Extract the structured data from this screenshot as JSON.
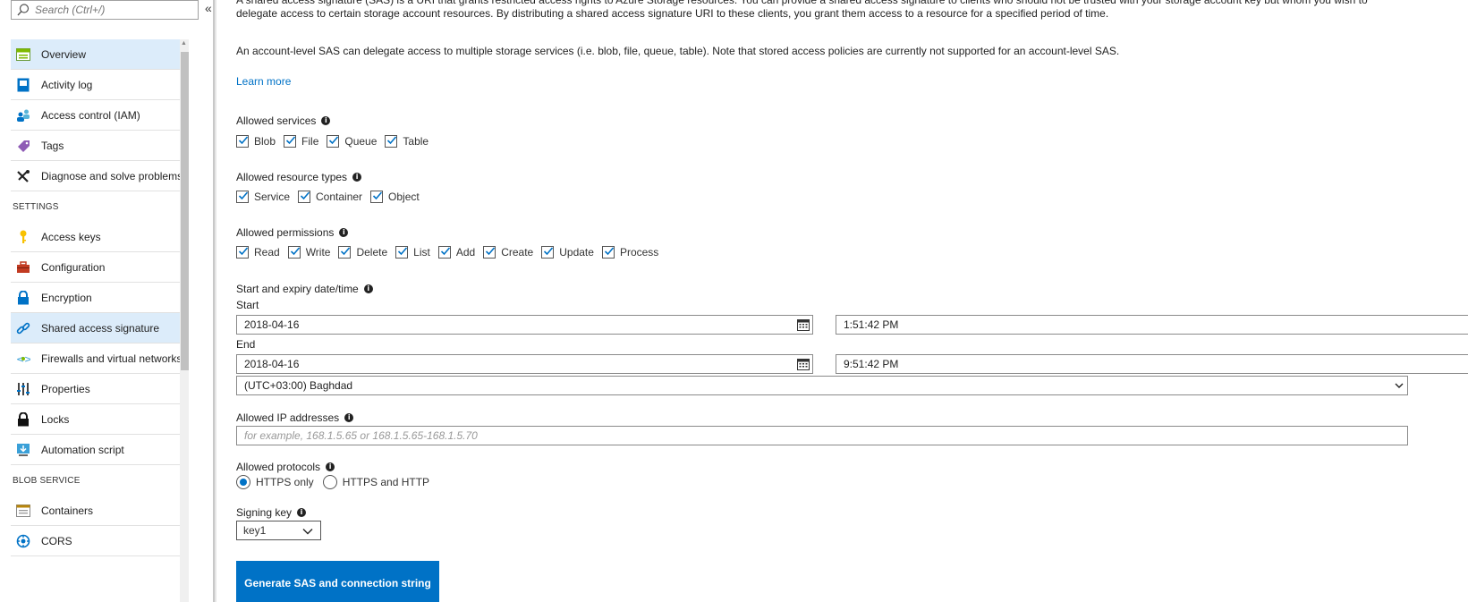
{
  "sidebar": {
    "search_placeholder": "Search (Ctrl+/)",
    "collapse_glyph": "«",
    "groups": [
      {
        "section": "",
        "items": [
          {
            "label": "Overview",
            "icon": "overview-icon",
            "active": true
          },
          {
            "label": "Activity log",
            "icon": "activity-log-icon"
          },
          {
            "label": "Access control (IAM)",
            "icon": "access-control-icon"
          },
          {
            "label": "Tags",
            "icon": "tag-icon"
          },
          {
            "label": "Diagnose and solve problems",
            "icon": "wrench-icon"
          }
        ]
      },
      {
        "section": "SETTINGS",
        "items": [
          {
            "label": "Access keys",
            "icon": "key-icon"
          },
          {
            "label": "Configuration",
            "icon": "toolbox-icon"
          },
          {
            "label": "Encryption",
            "icon": "lock-icon"
          },
          {
            "label": "Shared access signature",
            "icon": "link-icon",
            "active": true
          },
          {
            "label": "Firewalls and virtual networks",
            "icon": "firewall-icon"
          },
          {
            "label": "Properties",
            "icon": "properties-icon"
          },
          {
            "label": "Locks",
            "icon": "padlock-icon"
          },
          {
            "label": "Automation script",
            "icon": "download-icon"
          }
        ]
      },
      {
        "section": "BLOB SERVICE",
        "items": [
          {
            "label": "Containers",
            "icon": "container-icon"
          },
          {
            "label": "CORS",
            "icon": "cors-icon"
          }
        ]
      }
    ]
  },
  "main": {
    "description": "A shared access signature (SAS) is a URI that grants restricted access rights to Azure Storage resources. You can provide a shared access signature to clients who should not be trusted with your storage account key but whom you wish to delegate access to certain storage account resources. By distributing a shared access signature URI to these clients, you grant them access to a resource for a specified period of time.",
    "description2": "An account-level SAS can delegate access to multiple storage services (i.e. blob, file, queue, table). Note that stored access policies are currently not supported for an account-level SAS.",
    "learn_more": "Learn more",
    "allowed_services": {
      "label": "Allowed services",
      "options": [
        "Blob",
        "File",
        "Queue",
        "Table"
      ]
    },
    "allowed_resource_types": {
      "label": "Allowed resource types",
      "options": [
        "Service",
        "Container",
        "Object"
      ]
    },
    "allowed_permissions": {
      "label": "Allowed permissions",
      "options": [
        "Read",
        "Write",
        "Delete",
        "List",
        "Add",
        "Create",
        "Update",
        "Process"
      ]
    },
    "datetime": {
      "label": "Start and expiry date/time",
      "start_label": "Start",
      "start_date": "2018-04-16",
      "start_time": "1:51:42 PM",
      "end_label": "End",
      "end_date": "2018-04-16",
      "end_time": "9:51:42 PM",
      "timezone": "(UTC+03:00) Baghdad"
    },
    "allowed_ip": {
      "label": "Allowed IP addresses",
      "placeholder": "for example, 168.1.5.65 or 168.1.5.65-168.1.5.70"
    },
    "allowed_protocols": {
      "label": "Allowed protocols",
      "options": [
        "HTTPS only",
        "HTTPS and HTTP"
      ],
      "selected": "HTTPS only"
    },
    "signing_key": {
      "label": "Signing key",
      "value": "key1"
    },
    "generate_button": "Generate SAS and connection string"
  },
  "colors": {
    "accent": "#0072c6",
    "active_nav": "#dcecfa"
  }
}
